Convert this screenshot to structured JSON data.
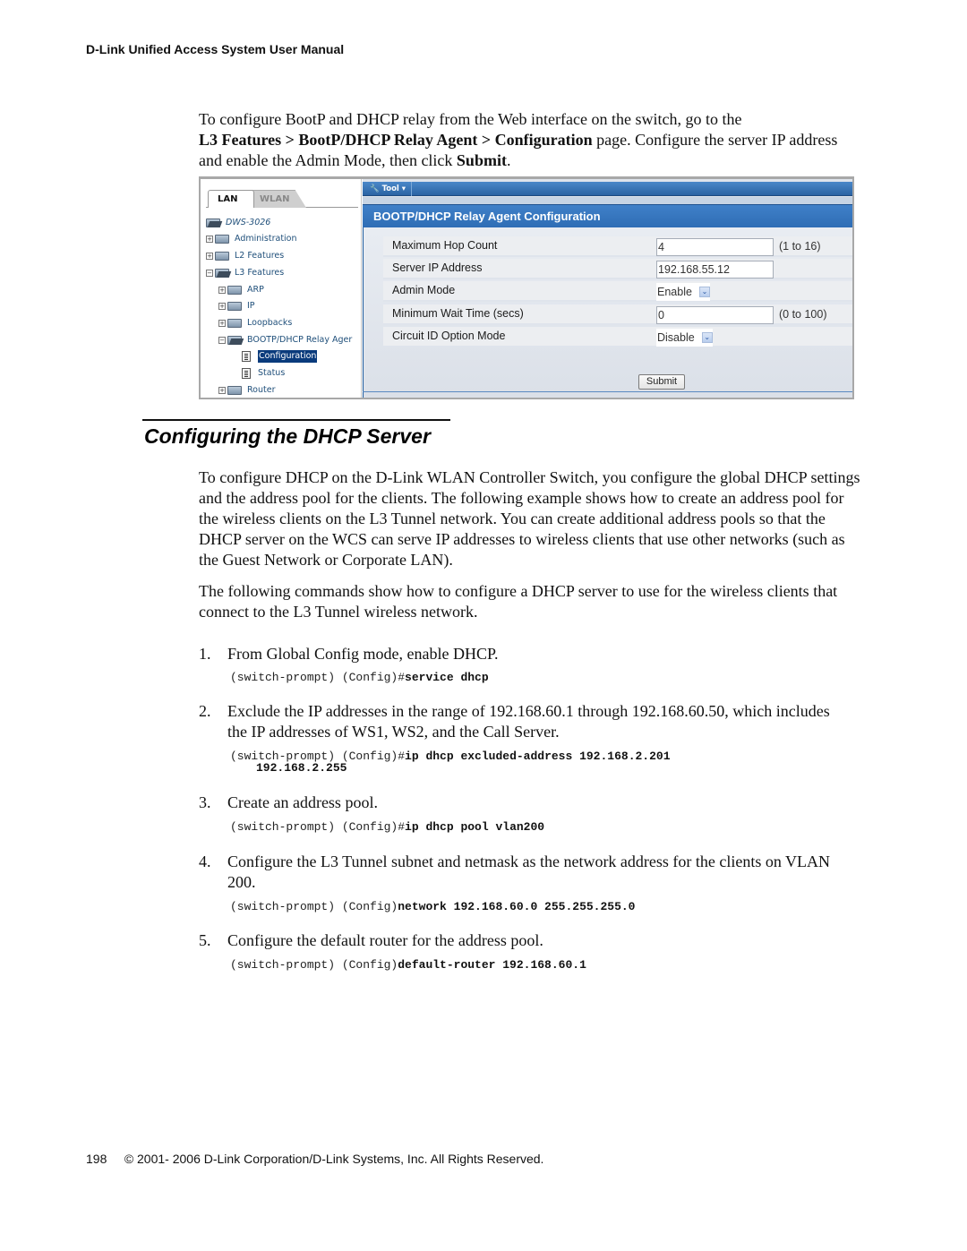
{
  "header": {
    "title": "D-Link Unified Access System User Manual"
  },
  "intro": {
    "line1": "To configure BootP and DHCP relay from the Web interface on the switch, go to the",
    "path_bold": "L3 Features > BootP/DHCP Relay Agent > Configuration",
    "line2_rest": " page. Configure the server IP address and enable the Admin Mode, then click ",
    "submit_bold": "Submit",
    "end": "."
  },
  "screenshot": {
    "tabs": [
      {
        "label": "LAN",
        "active": true
      },
      {
        "label": "WLAN",
        "active": false
      }
    ],
    "tree": {
      "root": "DWS-3026",
      "items": [
        {
          "label": "Administration",
          "expander": "+",
          "level": 0
        },
        {
          "label": "L2 Features",
          "expander": "+",
          "level": 0
        },
        {
          "label": "L3 Features",
          "expander": "-",
          "level": 0
        },
        {
          "label": "ARP",
          "expander": "+",
          "level": 1
        },
        {
          "label": "IP",
          "expander": "+",
          "level": 1
        },
        {
          "label": "Loopbacks",
          "expander": "+",
          "level": 1
        },
        {
          "label": "BOOTP/DHCP Relay Ager",
          "expander": "-",
          "level": 1
        },
        {
          "label": "Configuration",
          "level": 2,
          "selected": true
        },
        {
          "label": "Status",
          "level": 2
        },
        {
          "label": "Router",
          "expander": "+",
          "level": 1
        }
      ]
    },
    "toolbar": {
      "tool_label": "Tool ▾"
    },
    "panel_title": "BOOTP/DHCP Relay Agent Configuration",
    "fields": [
      {
        "label": "Maximum Hop Count",
        "type": "text",
        "value": "4",
        "hint": "(1 to 16)"
      },
      {
        "label": "Server IP Address",
        "type": "text",
        "value": "192.168.55.12",
        "hint": ""
      },
      {
        "label": "Admin Mode",
        "type": "select",
        "value": "Enable",
        "hint": ""
      },
      {
        "label": "Minimum Wait Time (secs)",
        "type": "text",
        "value": "0",
        "hint": "(0 to 100)"
      },
      {
        "label": "Circuit ID Option Mode",
        "type": "select",
        "value": "Disable",
        "hint": ""
      }
    ],
    "submit_label": "Submit",
    "colors": {
      "accent": "#2e6db5",
      "selection": "#0a3b7c",
      "form_bg": "#dfe4ec"
    }
  },
  "section": {
    "title": "Configuring the DHCP Server"
  },
  "paragraphs": [
    "To configure DHCP on the D-Link WLAN Controller Switch, you configure the global DHCP settings and the address pool for the clients. The following example shows how to create an address pool for the wireless clients on the L3 Tunnel network. You can create additional address pools so that the DHCP server on the WCS can serve IP addresses to wireless clients that use other networks (such as the Guest Network or Corporate LAN).",
    "The following commands show how to configure a DHCP server to use for the wireless clients that connect to the L3 Tunnel wireless network."
  ],
  "steps": [
    {
      "num": "1.",
      "text": "From Global Config mode, enable DHCP.",
      "prompt": "(switch-prompt) (Config)#",
      "command": "service dhcp",
      "cont": ""
    },
    {
      "num": "2.",
      "text": "Exclude the IP addresses in the range of 192.168.60.1 through 192.168.60.50, which includes the IP addresses of WS1, WS2, and the Call Server.",
      "prompt": "(switch-prompt) (Config)#",
      "command": "ip dhcp excluded-address 192.168.2.201",
      "cont": "192.168.2.255"
    },
    {
      "num": "3.",
      "text": "Create an address pool.",
      "prompt": "(switch-prompt) (Config)#",
      "command": "ip dhcp pool vlan200",
      "cont": ""
    },
    {
      "num": "4.",
      "text": "Configure the L3 Tunnel subnet and netmask as the network address for the clients on VLAN 200.",
      "prompt": "(switch-prompt) (Config)",
      "command": "network 192.168.60.0 255.255.255.0",
      "cont": ""
    },
    {
      "num": "5.",
      "text": "Configure the default router for the address pool.",
      "prompt": "(switch-prompt) (Config)",
      "command": "default-router 192.168.60.1",
      "cont": ""
    }
  ],
  "footer": {
    "page": "198",
    "copyright": "© 2001- 2006 D-Link Corporation/D-Link Systems, Inc. All Rights Reserved."
  }
}
